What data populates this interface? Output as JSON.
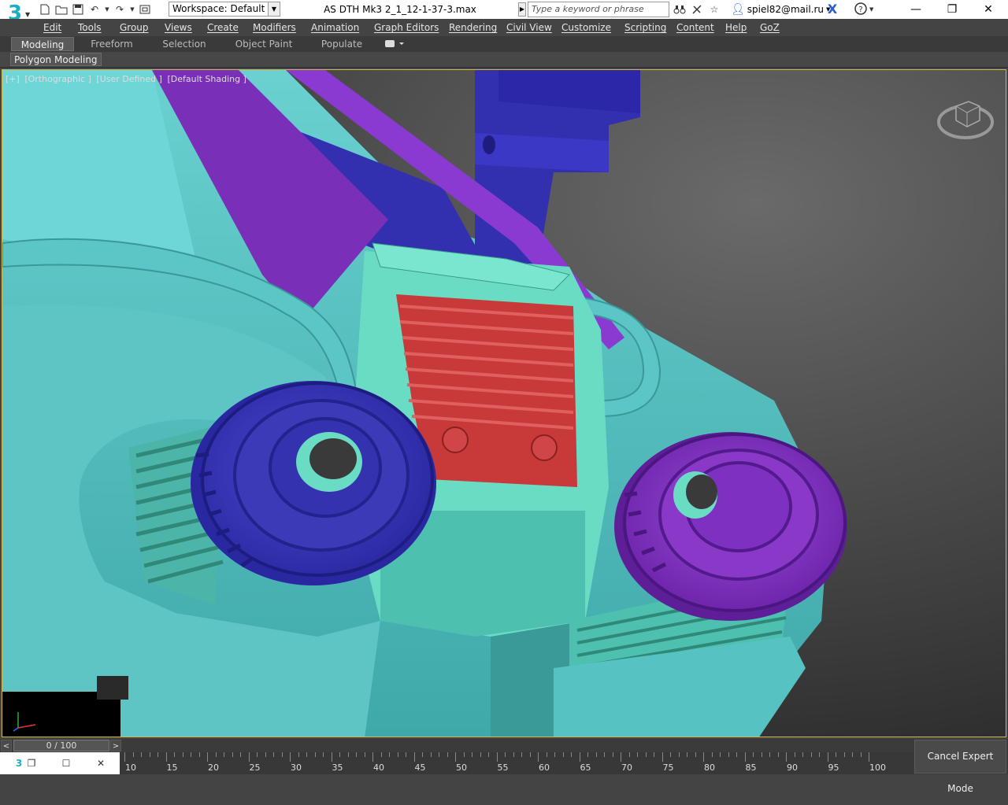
{
  "titlebar": {
    "logo_digit": "3",
    "workspace_label": "Workspace: Default",
    "document_title": "AS DTH Mk3 2_1_12-1-37-3.max",
    "search_placeholder": "Type a keyword or phrase",
    "user": "spiel82@mail.ru",
    "icons": [
      "new-file-icon",
      "open-file-icon",
      "save-icon",
      "undo-icon",
      "redo-icon",
      "project-icon"
    ]
  },
  "menu": {
    "items": [
      "Edit",
      "Tools",
      "Group",
      "Views",
      "Create",
      "Modifiers",
      "Animation",
      "Graph Editors",
      "Rendering",
      "Civil View",
      "Customize",
      "Scripting",
      "Content",
      "Help",
      "GoZ"
    ]
  },
  "ribbon": {
    "tabs": [
      "Modeling",
      "Freeform",
      "Selection",
      "Object Paint",
      "Populate"
    ],
    "active_tab": "Modeling",
    "panel_button": "Polygon Modeling"
  },
  "viewport": {
    "labels": [
      "[+]",
      "[Orthographic ]",
      "[User Defined ]",
      "[Default Shading ]"
    ],
    "colors": {
      "teal": "#5ec8c8",
      "teal_dark": "#3a9a9a",
      "mint": "#66d8c0",
      "purple": "#7a2fb8",
      "violet": "#9040d0",
      "blue": "#3d3ab8",
      "red": "#c83a3a",
      "background": "#3e3e3e"
    }
  },
  "timeline": {
    "frame_readout": "0 / 100",
    "prev_label": "<",
    "next_label": ">",
    "current_frame": 0,
    "total_frames": 100,
    "tick_labels": [
      "10",
      "15",
      "20",
      "25",
      "30",
      "35",
      "40",
      "45",
      "50",
      "55",
      "60",
      "65",
      "70",
      "75",
      "80",
      "85",
      "90",
      "95",
      "100"
    ]
  },
  "status": {
    "cancel_expert_label": "Cancel Expert Mode"
  }
}
